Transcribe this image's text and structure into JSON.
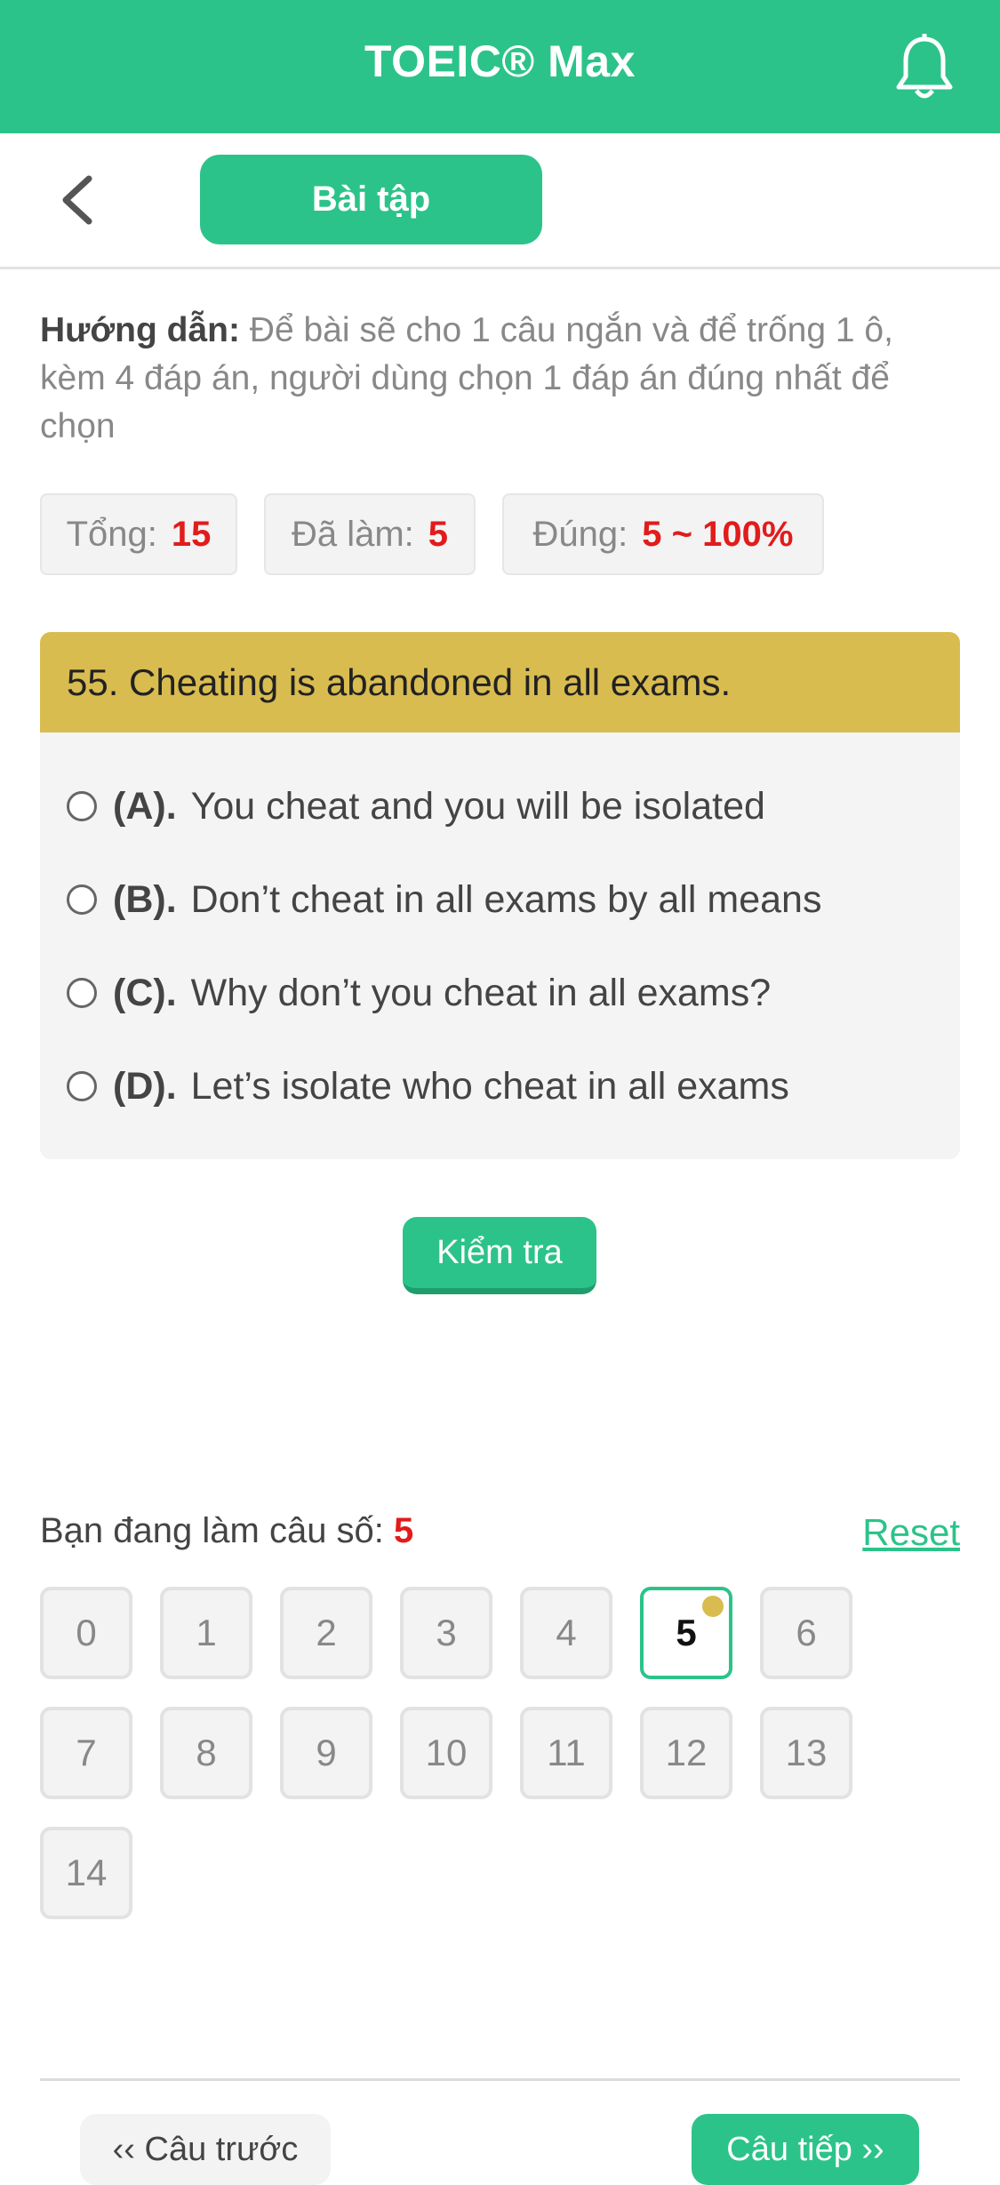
{
  "header": {
    "title": "TOEIC® Max",
    "icon": "bell-icon"
  },
  "subheader": {
    "tab_label": "Bài tập",
    "back_icon": "chevron-left-icon"
  },
  "instructions": {
    "label": "Hướng dẫn:",
    "text": " Để bài sẽ cho 1 câu ngắn và để trống 1 ô, kèm 4 đáp án, người dùng chọn 1 đáp án đúng nhất để chọn"
  },
  "stats": {
    "total_label": "Tổng:",
    "total_value": "15",
    "done_label": "Đã làm:",
    "done_value": "5",
    "correct_label": "Đúng:",
    "correct_value": "5 ~ 100%"
  },
  "question": {
    "text": "55. Cheating is abandoned in all exams.",
    "options": [
      {
        "key": "(A).",
        "text": "You cheat and you will be isolated"
      },
      {
        "key": "(B).",
        "text": "Don’t cheat in all exams by all means"
      },
      {
        "key": "(C).",
        "text": "Why don’t you cheat in all exams?"
      },
      {
        "key": "(D).",
        "text": "Let’s isolate who cheat in all exams"
      }
    ]
  },
  "check_button": "Kiểm tra",
  "progress": {
    "label": "Bạn đang làm câu số: ",
    "current": "5",
    "reset": "Reset"
  },
  "question_numbers": [
    "0",
    "1",
    "2",
    "3",
    "4",
    "5",
    "6",
    "7",
    "8",
    "9",
    "10",
    "11",
    "12",
    "13",
    "14"
  ],
  "active_question": "5",
  "nav": {
    "prev": "‹‹ Câu trước",
    "next": "Câu tiếp ››"
  },
  "colors": {
    "primary": "#2cc38a",
    "question_header": "#d9bc50",
    "highlight_number": "#e21b1b"
  }
}
